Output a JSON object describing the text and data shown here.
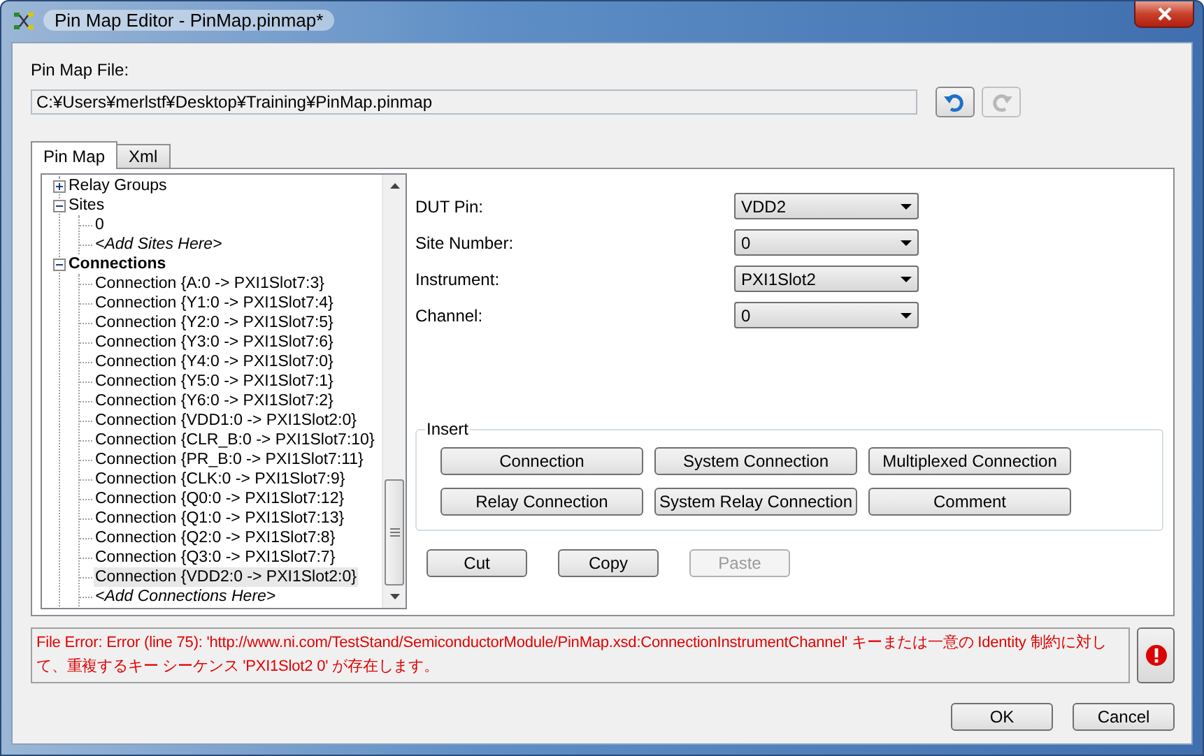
{
  "window": {
    "title": "Pin Map Editor - PinMap.pinmap*"
  },
  "file": {
    "label": "Pin Map File:",
    "value": "C:¥Users¥merlstf¥Desktop¥Training¥PinMap.pinmap"
  },
  "history_buttons": [
    {
      "kind": "undo",
      "disabled": false
    },
    {
      "kind": "redo",
      "disabled": true
    }
  ],
  "tabs": [
    {
      "label": "Pin Map",
      "selected": true
    },
    {
      "label": "Xml",
      "selected": false
    }
  ],
  "tree": [
    {
      "label": "Relay Groups",
      "kind": "node",
      "bold": false,
      "expanded": false,
      "selected": false
    },
    {
      "label": "Sites",
      "kind": "node",
      "bold": false,
      "expanded": true,
      "selected": false,
      "children": [
        {
          "label": "0",
          "kind": "node",
          "bold": false,
          "selected": false
        },
        {
          "label": "<Add Sites Here>",
          "kind": "placeholder",
          "bold": false,
          "selected": false
        }
      ]
    },
    {
      "label": "Connections",
      "kind": "node",
      "bold": true,
      "expanded": true,
      "selected": false,
      "children": [
        {
          "label": "Connection {A:0 -> PXI1Slot7:3}",
          "kind": "node",
          "bold": false,
          "selected": false
        },
        {
          "label": "Connection {Y1:0 -> PXI1Slot7:4}",
          "kind": "node",
          "bold": false,
          "selected": false
        },
        {
          "label": "Connection {Y2:0 -> PXI1Slot7:5}",
          "kind": "node",
          "bold": false,
          "selected": false
        },
        {
          "label": "Connection {Y3:0 -> PXI1Slot7:6}",
          "kind": "node",
          "bold": false,
          "selected": false
        },
        {
          "label": "Connection {Y4:0 -> PXI1Slot7:0}",
          "kind": "node",
          "bold": false,
          "selected": false
        },
        {
          "label": "Connection {Y5:0 -> PXI1Slot7:1}",
          "kind": "node",
          "bold": false,
          "selected": false
        },
        {
          "label": "Connection {Y6:0 -> PXI1Slot7:2}",
          "kind": "node",
          "bold": false,
          "selected": false
        },
        {
          "label": "Connection {VDD1:0 -> PXI1Slot2:0}",
          "kind": "node",
          "bold": false,
          "selected": false
        },
        {
          "label": "Connection {CLR_B:0 -> PXI1Slot7:10}",
          "kind": "node",
          "bold": false,
          "selected": false
        },
        {
          "label": "Connection {PR_B:0 -> PXI1Slot7:11}",
          "kind": "node",
          "bold": false,
          "selected": false
        },
        {
          "label": "Connection {CLK:0 -> PXI1Slot7:9}",
          "kind": "node",
          "bold": false,
          "selected": false
        },
        {
          "label": "Connection {Q0:0 -> PXI1Slot7:12}",
          "kind": "node",
          "bold": false,
          "selected": false
        },
        {
          "label": "Connection {Q1:0 -> PXI1Slot7:13}",
          "kind": "node",
          "bold": false,
          "selected": false
        },
        {
          "label": "Connection {Q2:0 -> PXI1Slot7:8}",
          "kind": "node",
          "bold": false,
          "selected": false
        },
        {
          "label": "Connection {Q3:0 -> PXI1Slot7:7}",
          "kind": "node",
          "bold": false,
          "selected": false
        },
        {
          "label": "Connection {VDD2:0 -> PXI1Slot2:0}",
          "kind": "node",
          "bold": false,
          "selected": true
        },
        {
          "label": "<Add Connections Here>",
          "kind": "placeholder",
          "bold": false,
          "selected": false
        }
      ]
    }
  ],
  "fields": [
    {
      "label": "DUT Pin:",
      "value": "VDD2"
    },
    {
      "label": "Site Number:",
      "value": "0"
    },
    {
      "label": "Instrument:",
      "value": "PXI1Slot2"
    },
    {
      "label": "Channel:",
      "value": "0"
    }
  ],
  "insert": {
    "title": "Insert",
    "buttons": [
      "Connection",
      "System Connection",
      "Multiplexed Connection",
      "Relay Connection",
      "System Relay Connection",
      "Comment"
    ]
  },
  "edit_buttons": [
    {
      "label": "Cut",
      "disabled": false
    },
    {
      "label": "Copy",
      "disabled": false
    },
    {
      "label": "Paste",
      "disabled": true
    }
  ],
  "error": {
    "message": "File Error: Error (line 75): 'http://www.ni.com/TestStand/SemiconductorModule/PinMap.xsd:ConnectionInstrumentChannel' キーまたは一意の Identity 制約に対して、重複するキー シーケンス 'PXI1Slot2 0' が存在します。"
  },
  "dialog_buttons": [
    "OK",
    "Cancel"
  ]
}
